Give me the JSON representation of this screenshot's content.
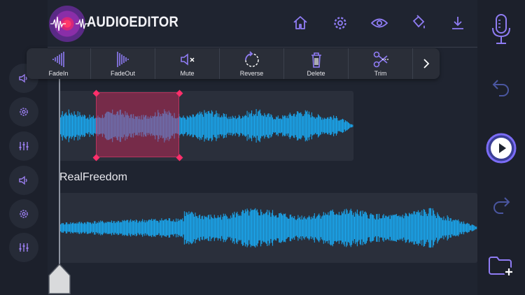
{
  "app": {
    "title": "AUDIOEDITOR"
  },
  "header": {
    "icons": [
      "home-icon",
      "settings-gear-icon",
      "preview-eye-icon",
      "fill-bucket-icon",
      "download-icon"
    ]
  },
  "toolbar": {
    "items": [
      {
        "label": "FadeIn",
        "icon": "fade-in-icon"
      },
      {
        "label": "FadeOut",
        "icon": "fade-out-icon"
      },
      {
        "label": "Mute",
        "icon": "mute-icon"
      },
      {
        "label": "Reverse",
        "icon": "reverse-icon"
      },
      {
        "label": "Delete",
        "icon": "trash-icon"
      },
      {
        "label": "Trim",
        "icon": "scissors-icon"
      }
    ],
    "more_icon": "chevron-right-icon"
  },
  "tracks": [
    {
      "name": ""
    },
    {
      "name": "RealFreedom"
    }
  ],
  "left_rail": [
    "volume-icon",
    "settings-gear-icon",
    "equalizer-icon",
    "volume-icon",
    "settings-gear-icon",
    "equalizer-icon"
  ],
  "right_rail": [
    "microphone-icon",
    "undo-icon",
    "play-icon",
    "redo-icon",
    "add-folder-icon"
  ],
  "colors": {
    "accent": "#7b6cf6",
    "wave": "#1aa6ee",
    "selection": "#d2285a",
    "background": "#1f2430"
  }
}
